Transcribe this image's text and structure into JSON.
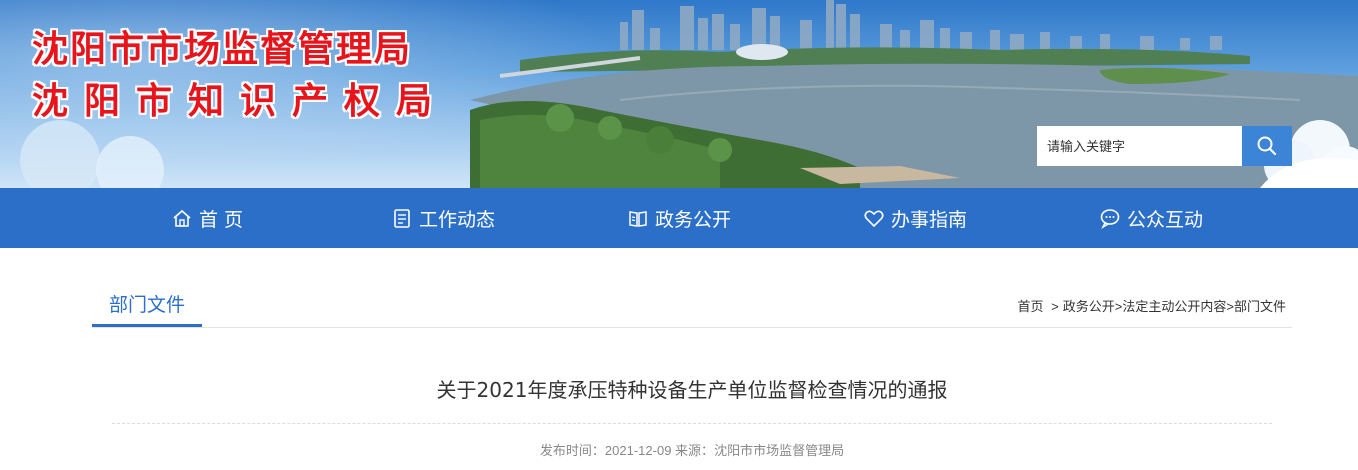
{
  "site": {
    "title_line1": "沈阳市市场监督管理局",
    "title_line2": "沈阳市知识产权局"
  },
  "search": {
    "placeholder": "请输入关键字",
    "icon": "search-icon"
  },
  "nav": {
    "items": [
      {
        "label": "首 页",
        "icon": "home-icon"
      },
      {
        "label": "工作动态",
        "icon": "document-icon"
      },
      {
        "label": "政务公开",
        "icon": "book-icon"
      },
      {
        "label": "办事指南",
        "icon": "heart-icon"
      },
      {
        "label": "公众互动",
        "icon": "chat-icon"
      }
    ]
  },
  "section": {
    "title": "部门文件"
  },
  "breadcrumb": {
    "items": [
      "首页",
      "政务公开",
      "法定主动公开内容",
      "部门文件"
    ],
    "separators": [
      ">",
      ">",
      ">"
    ]
  },
  "article": {
    "title": "关于2021年度承压特种设备生产单位监督检查情况的通报",
    "publish_label": "发布时间：",
    "publish_date": "2021-12-09",
    "source_label": "来源：",
    "source": "沈阳市市场监督管理局"
  },
  "colors": {
    "primary": "#2b6fc8",
    "title_red": "#e8141c",
    "search_button": "#3c85d6"
  }
}
